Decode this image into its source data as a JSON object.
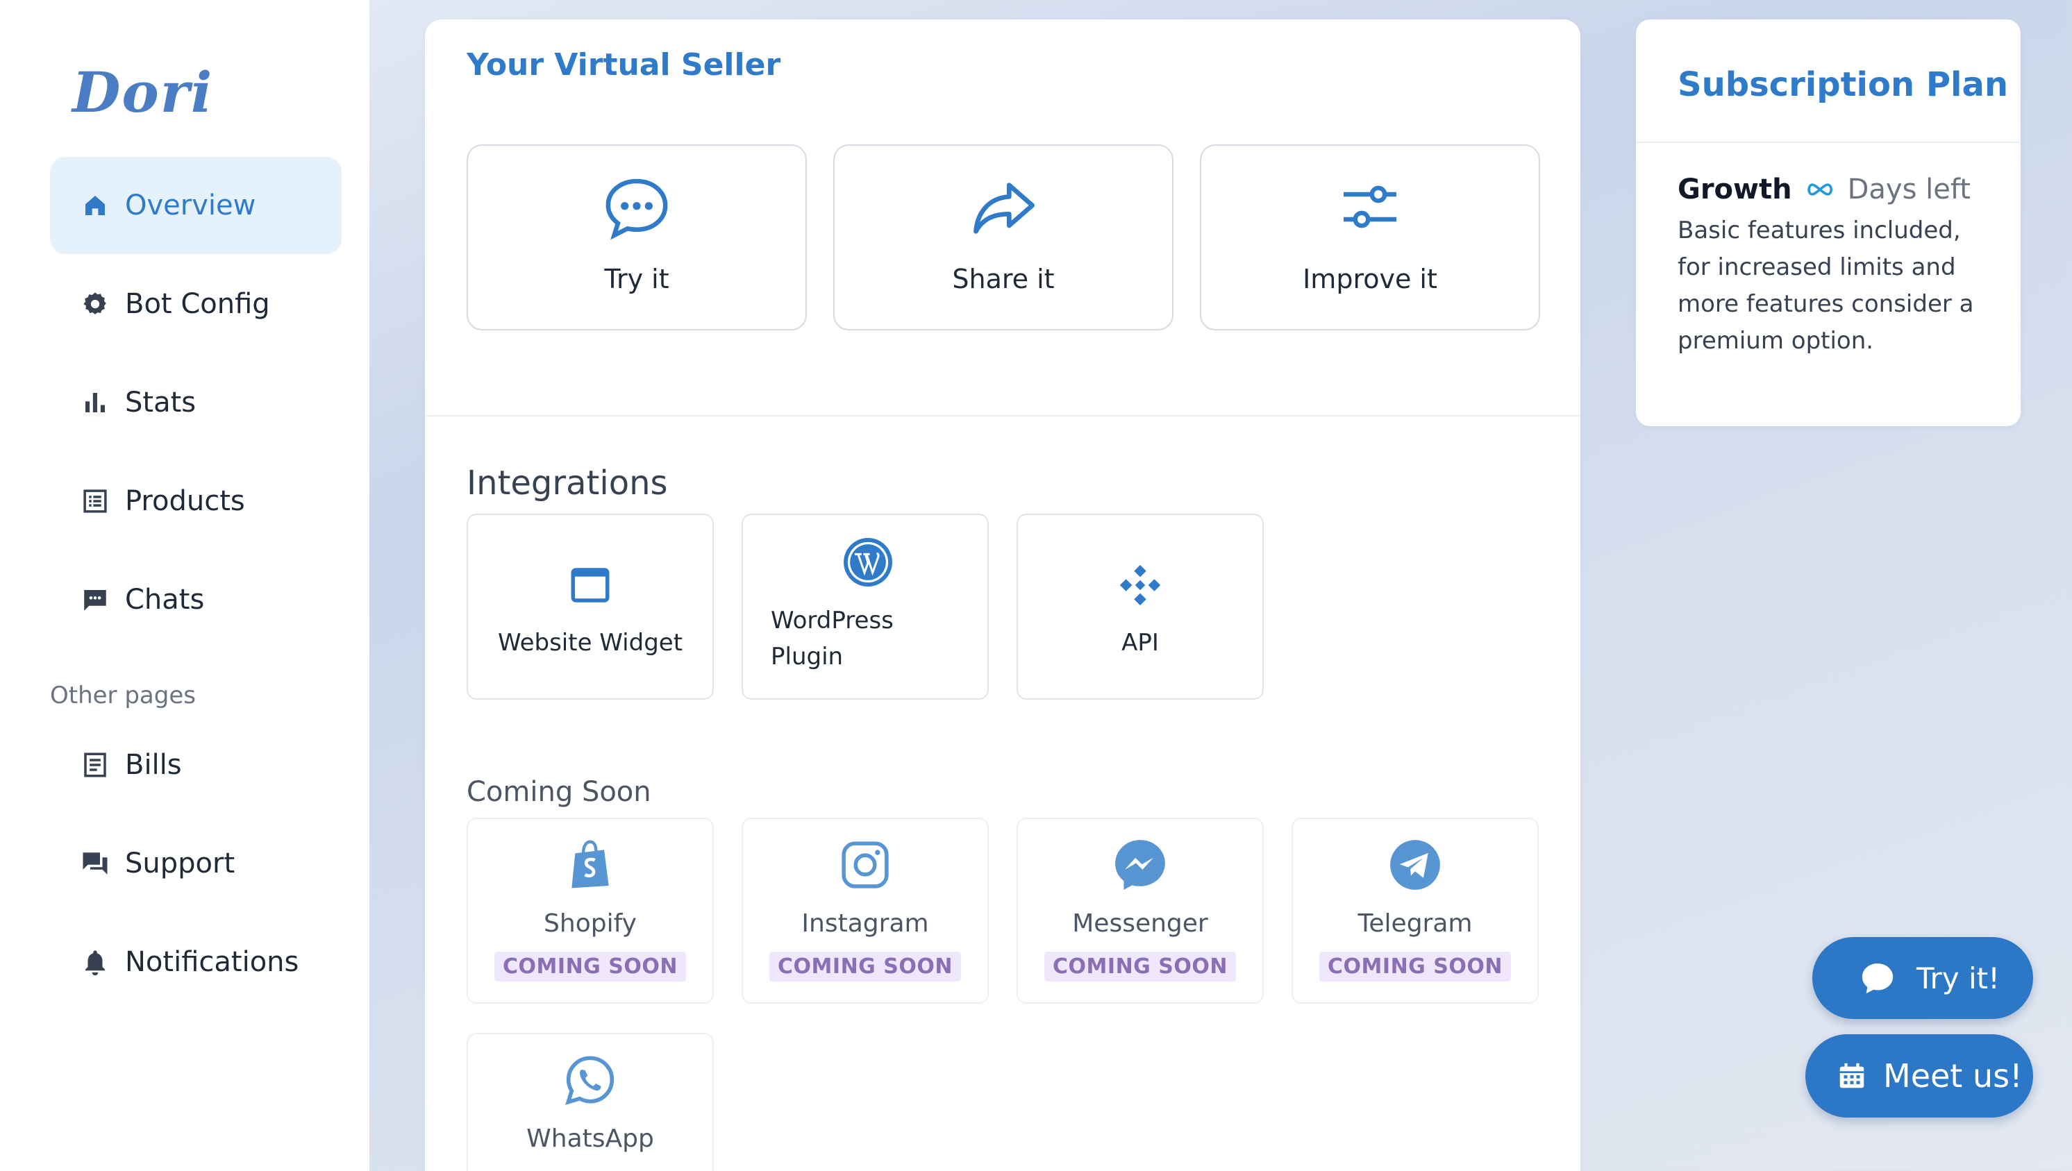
{
  "sidebar": {
    "logo": "Dori",
    "items": [
      {
        "label": "Overview",
        "icon": "home-icon",
        "active": true
      },
      {
        "label": "Bot Config",
        "icon": "gear-icon"
      },
      {
        "label": "Stats",
        "icon": "bar-chart-icon"
      },
      {
        "label": "Products",
        "icon": "list-icon"
      },
      {
        "label": "Chats",
        "icon": "chat-icon"
      }
    ],
    "other_label": "Other pages",
    "other_items": [
      {
        "label": "Bills",
        "icon": "receipt-icon"
      },
      {
        "label": "Support",
        "icon": "support-chat-icon"
      },
      {
        "label": "Notifications",
        "icon": "bell-icon"
      }
    ]
  },
  "virtual_seller": {
    "title": "Your Virtual Seller",
    "actions": [
      {
        "label": "Try it",
        "icon": "speech-bubble-icon"
      },
      {
        "label": "Share it",
        "icon": "share-arrow-icon"
      },
      {
        "label": "Improve it",
        "icon": "sliders-icon"
      }
    ]
  },
  "integrations": {
    "title": "Integrations",
    "items": [
      {
        "label": "Website Widget",
        "icon": "browser-window-icon"
      },
      {
        "label": "WordPress Plugin",
        "icon": "wordpress-icon"
      },
      {
        "label": "API",
        "icon": "api-icon"
      }
    ]
  },
  "coming_soon": {
    "title": "Coming Soon",
    "badge": "COMING SOON",
    "items": [
      {
        "label": "Shopify",
        "icon": "shopify-icon"
      },
      {
        "label": "Instagram",
        "icon": "instagram-icon"
      },
      {
        "label": "Messenger",
        "icon": "messenger-icon"
      },
      {
        "label": "Telegram",
        "icon": "telegram-icon"
      },
      {
        "label": "WhatsApp",
        "icon": "whatsapp-icon"
      }
    ]
  },
  "subscription": {
    "title": "Subscription Plan",
    "plan": "Growth",
    "days_label": "Days left",
    "description": "Basic features included, for increased limits and more features consider a premium option."
  },
  "floating": {
    "try_label": "Try it!",
    "meet_label": "Meet us!"
  },
  "colors": {
    "accent": "#2f7bc9",
    "button": "#2c77c6",
    "active_bg": "#e5f2fc",
    "badge_bg": "#efe7fb",
    "badge_text": "#8b6fb5"
  }
}
